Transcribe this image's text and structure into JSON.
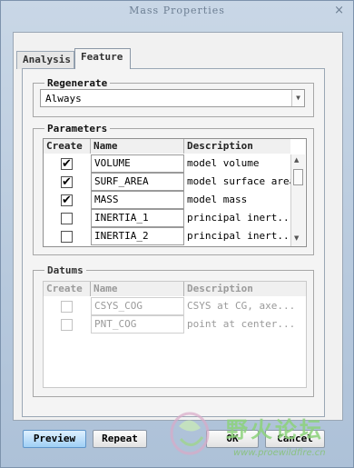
{
  "window": {
    "title": "Mass Properties",
    "close_glyph": "×"
  },
  "tabs": [
    {
      "label": "Analysis",
      "active": false
    },
    {
      "label": "Feature",
      "active": true
    }
  ],
  "regenerate": {
    "legend": "Regenerate",
    "selected": "Always"
  },
  "parameters": {
    "legend": "Parameters",
    "columns": [
      "Create",
      "Name",
      "Description"
    ],
    "rows": [
      {
        "checked": true,
        "name": "VOLUME",
        "description": "model volume"
      },
      {
        "checked": true,
        "name": "SURF_AREA",
        "description": "model surface area"
      },
      {
        "checked": true,
        "name": "MASS",
        "description": "model mass"
      },
      {
        "checked": false,
        "name": "INERTIA_1",
        "description": "principal inert..."
      },
      {
        "checked": false,
        "name": "INERTIA_2",
        "description": "principal inert..."
      }
    ]
  },
  "datums": {
    "legend": "Datums",
    "columns": [
      "Create",
      "Name",
      "Description"
    ],
    "rows": [
      {
        "checked": false,
        "name": "CSYS_COG",
        "description": "CSYS at CG, axe..."
      },
      {
        "checked": false,
        "name": "PNT_COG",
        "description": "point at center..."
      }
    ]
  },
  "buttons": {
    "preview": "Preview",
    "repeat": "Repeat",
    "ok": "OK",
    "cancel": "Cancel"
  },
  "watermark": {
    "text": "野火论坛",
    "url": "www.proewildfire.cn"
  },
  "colors": {
    "accent": "#9fcff5",
    "watermark": "#8cd37a"
  },
  "icons": {
    "check": "✔",
    "dropdown": "▼",
    "up": "▲",
    "down": "▼"
  }
}
